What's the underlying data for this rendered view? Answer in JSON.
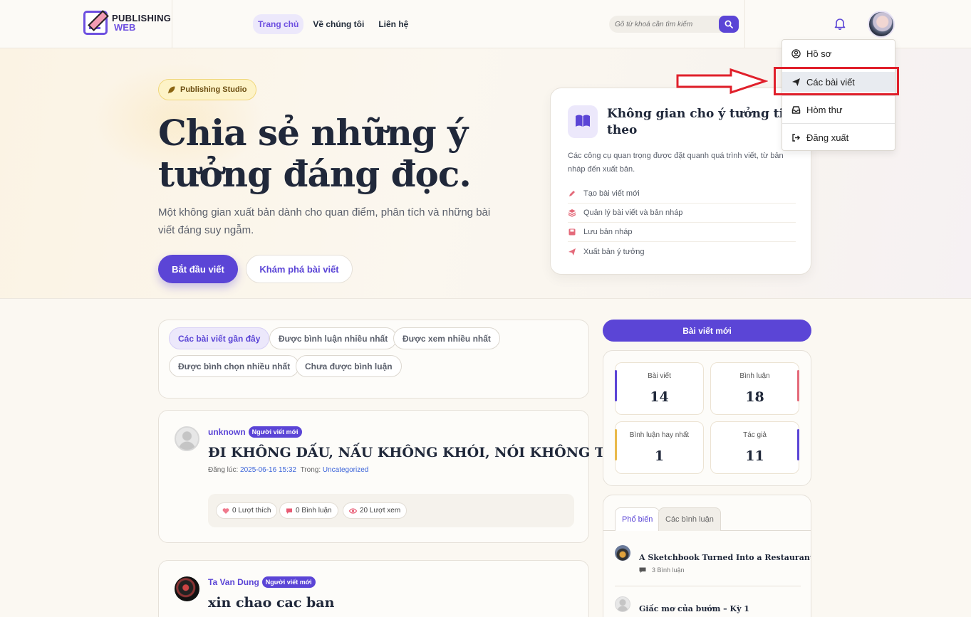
{
  "header": {
    "logo_line1": "PUBLISHING",
    "logo_line2": "WEB",
    "nav": [
      {
        "label": "Trang chủ",
        "active": true
      },
      {
        "label": "Về chúng tôi",
        "active": false
      },
      {
        "label": "Liên hệ",
        "active": false
      }
    ],
    "search_placeholder": "Gõ từ khoá cần tìm kiếm",
    "accent_color": "#5b45d6"
  },
  "user_menu": {
    "items": [
      {
        "label": "Hồ sơ",
        "icon": "user-circle-icon"
      },
      {
        "label": "Các bài viết",
        "icon": "paper-plane-icon",
        "highlighted": true
      },
      {
        "label": "Hòm thư",
        "icon": "inbox-icon"
      },
      {
        "label": "Đăng xuất",
        "icon": "logout-icon"
      }
    ]
  },
  "hero": {
    "badge": "Publishing Studio",
    "title": "Chia sẻ những ý tưởng đáng đọc.",
    "description": "Một không gian xuất bản dành cho quan điểm, phân tích và những bài viết đáng suy ngẫm.",
    "primary_button": "Bắt đầu viết",
    "secondary_button": "Khám phá bài viết"
  },
  "idea_card": {
    "title": "Không gian cho ý tưởng tiếp theo",
    "description": "Các công cụ quan trọng được đặt quanh quá trình viết, từ bản nháp đến xuất bản.",
    "items": [
      {
        "label": "Tạo bài viết mới",
        "icon": "pen-icon"
      },
      {
        "label": "Quản lý bài viết và bản nháp",
        "icon": "layers-icon"
      },
      {
        "label": "Lưu bản nháp",
        "icon": "save-icon"
      },
      {
        "label": "Xuất bản ý tưởng",
        "icon": "paper-plane-icon"
      }
    ]
  },
  "filters": [
    {
      "label": "Các bài viết gần đây",
      "active": true
    },
    {
      "label": "Được bình luận nhiều nhất",
      "active": false
    },
    {
      "label": "Được xem nhiều nhất",
      "active": false
    },
    {
      "label": "Được bình chọn nhiều nhất",
      "active": false
    },
    {
      "label": "Chưa được bình luận",
      "active": false
    }
  ],
  "posts": [
    {
      "author": "unknown",
      "tag": "Người viết mới",
      "title": "ĐI KHÔNG DẤU, NẤU KHÔNG KHÓI, NÓI KHÔNG TIẾNG",
      "meta_label": "Đăng lúc:",
      "date": "2025-06-16 15:32",
      "category_label": "Trong:",
      "category": "Uncategorized",
      "likes": "0 Lượt thích",
      "comments": "0 Bình luận",
      "views": "20 Lượt xem"
    },
    {
      "author": "Ta Van Dung",
      "tag": "Người viết mới",
      "title": "xin chao cac ban"
    }
  ],
  "sidebar": {
    "new_post_button": "Bài viết mới",
    "stats": [
      {
        "label": "Bài viết",
        "value": "14",
        "color": "#5b45d6"
      },
      {
        "label": "Bình luận",
        "value": "18",
        "color": "#e46a7a"
      },
      {
        "label": "Bình luận hay nhất",
        "value": "1",
        "color": "#e9b949"
      },
      {
        "label": "Tác giả",
        "value": "11",
        "color": "#5b45d6"
      }
    ],
    "tabs": [
      {
        "label": "Phổ biến",
        "active": true
      },
      {
        "label": "Các bình luận",
        "active": false
      }
    ],
    "popular": [
      {
        "title": "A Sketchbook Turned Into a Restaurant",
        "sub": "3 Bình luận"
      },
      {
        "title": "Giấc mơ của bướm – Kỳ 1",
        "sub": ""
      }
    ]
  }
}
